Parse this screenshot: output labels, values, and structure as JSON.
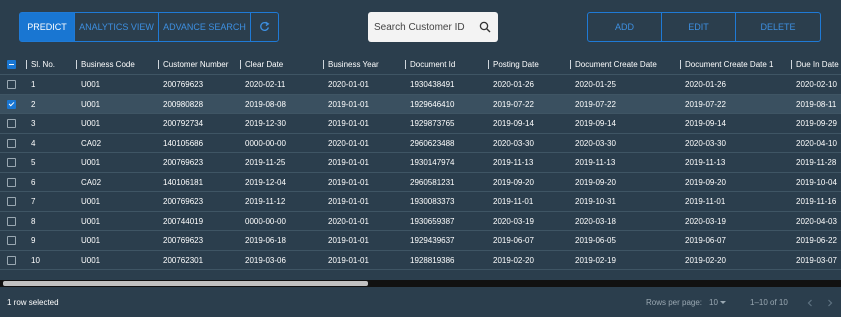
{
  "toolbar": {
    "predict": "PREDICT",
    "analytics": "ANALYTICS VIEW",
    "advance_search": "ADVANCE SEARCH",
    "add": "ADD",
    "edit": "EDIT",
    "delete": "DELETE"
  },
  "search": {
    "text": "Search Customer ID"
  },
  "colors": {
    "accent": "#1976d2",
    "background": "#2b3e4d",
    "button_text": "#3d8fe0"
  },
  "icons": {
    "refresh": "refresh-icon",
    "search": "search-icon",
    "prev": "chevron-left-icon",
    "next": "chevron-right-icon"
  },
  "table": {
    "headers": [
      "Sl. No.",
      "Business Code",
      "Customer Number",
      "Clear Date",
      "Business Year",
      "Document Id",
      "Posting Date",
      "Document Create Date",
      "Document Create Date 1",
      "Due In Date"
    ],
    "rows": [
      {
        "checked": false,
        "cells": [
          "1",
          "U001",
          "200769623",
          "2020-02-11",
          "2020-01-01",
          "1930438491",
          "2020-01-26",
          "2020-01-25",
          "2020-01-26",
          "2020-02-10"
        ]
      },
      {
        "checked": true,
        "cells": [
          "2",
          "U001",
          "200980828",
          "2019-08-08",
          "2019-01-01",
          "1929646410",
          "2019-07-22",
          "2019-07-22",
          "2019-07-22",
          "2019-08-11"
        ]
      },
      {
        "checked": false,
        "cells": [
          "3",
          "U001",
          "200792734",
          "2019-12-30",
          "2019-01-01",
          "1929873765",
          "2019-09-14",
          "2019-09-14",
          "2019-09-14",
          "2019-09-29"
        ]
      },
      {
        "checked": false,
        "cells": [
          "4",
          "CA02",
          "140105686",
          "0000-00-00",
          "2020-01-01",
          "2960623488",
          "2020-03-30",
          "2020-03-30",
          "2020-03-30",
          "2020-04-10"
        ]
      },
      {
        "checked": false,
        "cells": [
          "5",
          "U001",
          "200769623",
          "2019-11-25",
          "2019-01-01",
          "1930147974",
          "2019-11-13",
          "2019-11-13",
          "2019-11-13",
          "2019-11-28"
        ]
      },
      {
        "checked": false,
        "cells": [
          "6",
          "CA02",
          "140106181",
          "2019-12-04",
          "2019-01-01",
          "2960581231",
          "2019-09-20",
          "2019-09-20",
          "2019-09-20",
          "2019-10-04"
        ]
      },
      {
        "checked": false,
        "cells": [
          "7",
          "U001",
          "200769623",
          "2019-11-12",
          "2019-01-01",
          "1930083373",
          "2019-11-01",
          "2019-10-31",
          "2019-11-01",
          "2019-11-16"
        ]
      },
      {
        "checked": false,
        "cells": [
          "8",
          "U001",
          "200744019",
          "0000-00-00",
          "2020-01-01",
          "1930659387",
          "2020-03-19",
          "2020-03-18",
          "2020-03-19",
          "2020-04-03"
        ]
      },
      {
        "checked": false,
        "cells": [
          "9",
          "U001",
          "200769623",
          "2019-06-18",
          "2019-01-01",
          "1929439637",
          "2019-06-07",
          "2019-06-05",
          "2019-06-07",
          "2019-06-22"
        ]
      },
      {
        "checked": false,
        "cells": [
          "10",
          "U001",
          "200762301",
          "2019-03-06",
          "2019-01-01",
          "1928819386",
          "2019-02-20",
          "2019-02-19",
          "2019-02-20",
          "2019-03-07"
        ]
      }
    ]
  },
  "footer": {
    "selected": "1 row selected",
    "rows_per_page_label": "Rows per page:",
    "rows_per_page_value": "10",
    "page_range": "1–10 of 10"
  }
}
